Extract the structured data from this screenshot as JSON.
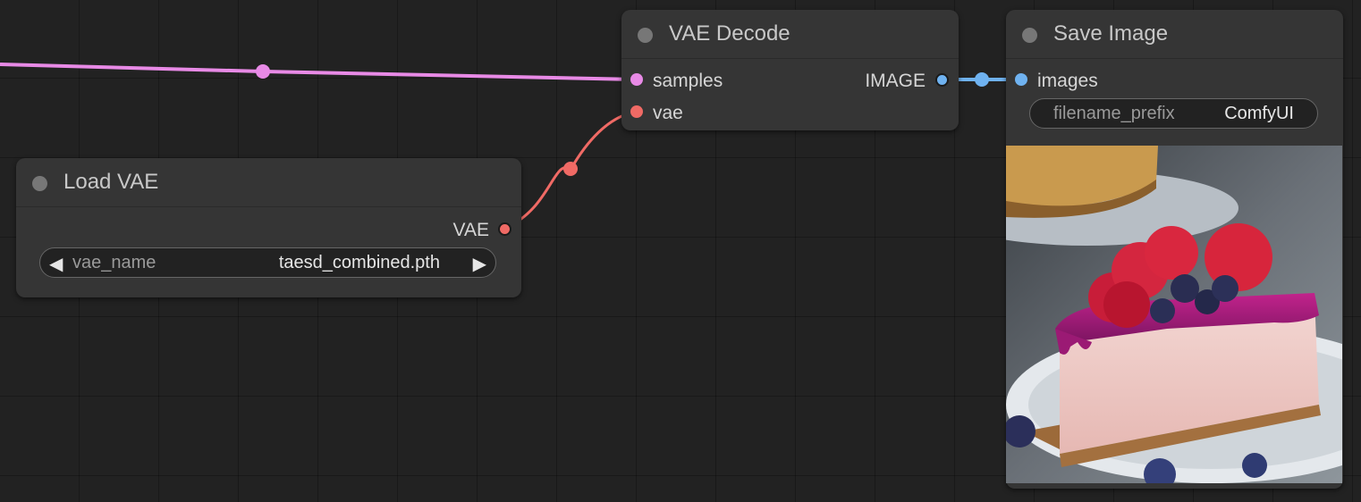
{
  "nodes": {
    "vae_decode": {
      "title": "VAE Decode",
      "inputs": [
        "samples",
        "vae"
      ],
      "outputs": [
        "IMAGE"
      ]
    },
    "save_image": {
      "title": "Save Image",
      "inputs": [
        "images"
      ],
      "widget": {
        "name": "filename_prefix",
        "value": "ComfyUI"
      },
      "preview": "cheesecake-image"
    },
    "load_vae": {
      "title": "Load VAE",
      "outputs": [
        "VAE"
      ],
      "widget": {
        "name": "vae_name",
        "value": "taesd_combined.pth",
        "left_arrow": "◀",
        "right_arrow": "▶"
      }
    }
  },
  "colors": {
    "latent": "#e88ae6",
    "vae": "#f06a65",
    "image": "#6fb2f0",
    "node_bg": "#353535",
    "canvas_bg": "#222222"
  }
}
